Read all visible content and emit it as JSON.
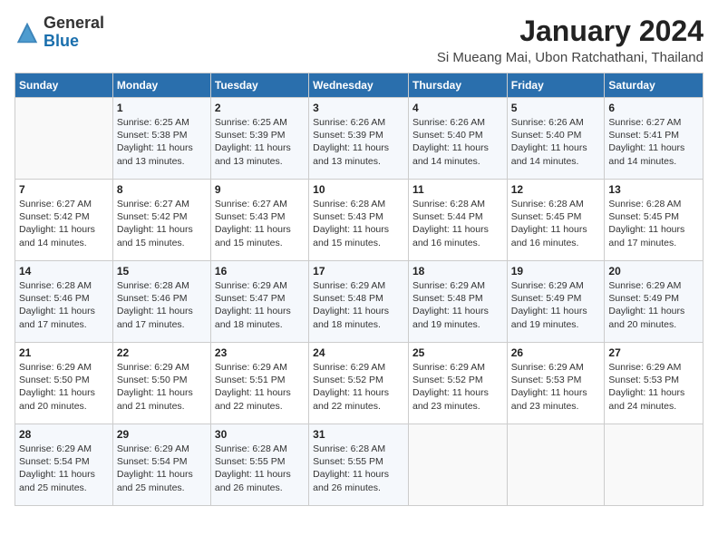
{
  "header": {
    "logo_general": "General",
    "logo_blue": "Blue",
    "month_year": "January 2024",
    "location": "Si Mueang Mai, Ubon Ratchathani, Thailand"
  },
  "weekdays": [
    "Sunday",
    "Monday",
    "Tuesday",
    "Wednesday",
    "Thursday",
    "Friday",
    "Saturday"
  ],
  "weeks": [
    [
      {
        "num": "",
        "text": ""
      },
      {
        "num": "1",
        "text": "Sunrise: 6:25 AM\nSunset: 5:38 PM\nDaylight: 11 hours\nand 13 minutes."
      },
      {
        "num": "2",
        "text": "Sunrise: 6:25 AM\nSunset: 5:39 PM\nDaylight: 11 hours\nand 13 minutes."
      },
      {
        "num": "3",
        "text": "Sunrise: 6:26 AM\nSunset: 5:39 PM\nDaylight: 11 hours\nand 13 minutes."
      },
      {
        "num": "4",
        "text": "Sunrise: 6:26 AM\nSunset: 5:40 PM\nDaylight: 11 hours\nand 14 minutes."
      },
      {
        "num": "5",
        "text": "Sunrise: 6:26 AM\nSunset: 5:40 PM\nDaylight: 11 hours\nand 14 minutes."
      },
      {
        "num": "6",
        "text": "Sunrise: 6:27 AM\nSunset: 5:41 PM\nDaylight: 11 hours\nand 14 minutes."
      }
    ],
    [
      {
        "num": "7",
        "text": "Sunrise: 6:27 AM\nSunset: 5:42 PM\nDaylight: 11 hours\nand 14 minutes."
      },
      {
        "num": "8",
        "text": "Sunrise: 6:27 AM\nSunset: 5:42 PM\nDaylight: 11 hours\nand 15 minutes."
      },
      {
        "num": "9",
        "text": "Sunrise: 6:27 AM\nSunset: 5:43 PM\nDaylight: 11 hours\nand 15 minutes."
      },
      {
        "num": "10",
        "text": "Sunrise: 6:28 AM\nSunset: 5:43 PM\nDaylight: 11 hours\nand 15 minutes."
      },
      {
        "num": "11",
        "text": "Sunrise: 6:28 AM\nSunset: 5:44 PM\nDaylight: 11 hours\nand 16 minutes."
      },
      {
        "num": "12",
        "text": "Sunrise: 6:28 AM\nSunset: 5:45 PM\nDaylight: 11 hours\nand 16 minutes."
      },
      {
        "num": "13",
        "text": "Sunrise: 6:28 AM\nSunset: 5:45 PM\nDaylight: 11 hours\nand 17 minutes."
      }
    ],
    [
      {
        "num": "14",
        "text": "Sunrise: 6:28 AM\nSunset: 5:46 PM\nDaylight: 11 hours\nand 17 minutes."
      },
      {
        "num": "15",
        "text": "Sunrise: 6:28 AM\nSunset: 5:46 PM\nDaylight: 11 hours\nand 17 minutes."
      },
      {
        "num": "16",
        "text": "Sunrise: 6:29 AM\nSunset: 5:47 PM\nDaylight: 11 hours\nand 18 minutes."
      },
      {
        "num": "17",
        "text": "Sunrise: 6:29 AM\nSunset: 5:48 PM\nDaylight: 11 hours\nand 18 minutes."
      },
      {
        "num": "18",
        "text": "Sunrise: 6:29 AM\nSunset: 5:48 PM\nDaylight: 11 hours\nand 19 minutes."
      },
      {
        "num": "19",
        "text": "Sunrise: 6:29 AM\nSunset: 5:49 PM\nDaylight: 11 hours\nand 19 minutes."
      },
      {
        "num": "20",
        "text": "Sunrise: 6:29 AM\nSunset: 5:49 PM\nDaylight: 11 hours\nand 20 minutes."
      }
    ],
    [
      {
        "num": "21",
        "text": "Sunrise: 6:29 AM\nSunset: 5:50 PM\nDaylight: 11 hours\nand 20 minutes."
      },
      {
        "num": "22",
        "text": "Sunrise: 6:29 AM\nSunset: 5:50 PM\nDaylight: 11 hours\nand 21 minutes."
      },
      {
        "num": "23",
        "text": "Sunrise: 6:29 AM\nSunset: 5:51 PM\nDaylight: 11 hours\nand 22 minutes."
      },
      {
        "num": "24",
        "text": "Sunrise: 6:29 AM\nSunset: 5:52 PM\nDaylight: 11 hours\nand 22 minutes."
      },
      {
        "num": "25",
        "text": "Sunrise: 6:29 AM\nSunset: 5:52 PM\nDaylight: 11 hours\nand 23 minutes."
      },
      {
        "num": "26",
        "text": "Sunrise: 6:29 AM\nSunset: 5:53 PM\nDaylight: 11 hours\nand 23 minutes."
      },
      {
        "num": "27",
        "text": "Sunrise: 6:29 AM\nSunset: 5:53 PM\nDaylight: 11 hours\nand 24 minutes."
      }
    ],
    [
      {
        "num": "28",
        "text": "Sunrise: 6:29 AM\nSunset: 5:54 PM\nDaylight: 11 hours\nand 25 minutes."
      },
      {
        "num": "29",
        "text": "Sunrise: 6:29 AM\nSunset: 5:54 PM\nDaylight: 11 hours\nand 25 minutes."
      },
      {
        "num": "30",
        "text": "Sunrise: 6:28 AM\nSunset: 5:55 PM\nDaylight: 11 hours\nand 26 minutes."
      },
      {
        "num": "31",
        "text": "Sunrise: 6:28 AM\nSunset: 5:55 PM\nDaylight: 11 hours\nand 26 minutes."
      },
      {
        "num": "",
        "text": ""
      },
      {
        "num": "",
        "text": ""
      },
      {
        "num": "",
        "text": ""
      }
    ]
  ]
}
